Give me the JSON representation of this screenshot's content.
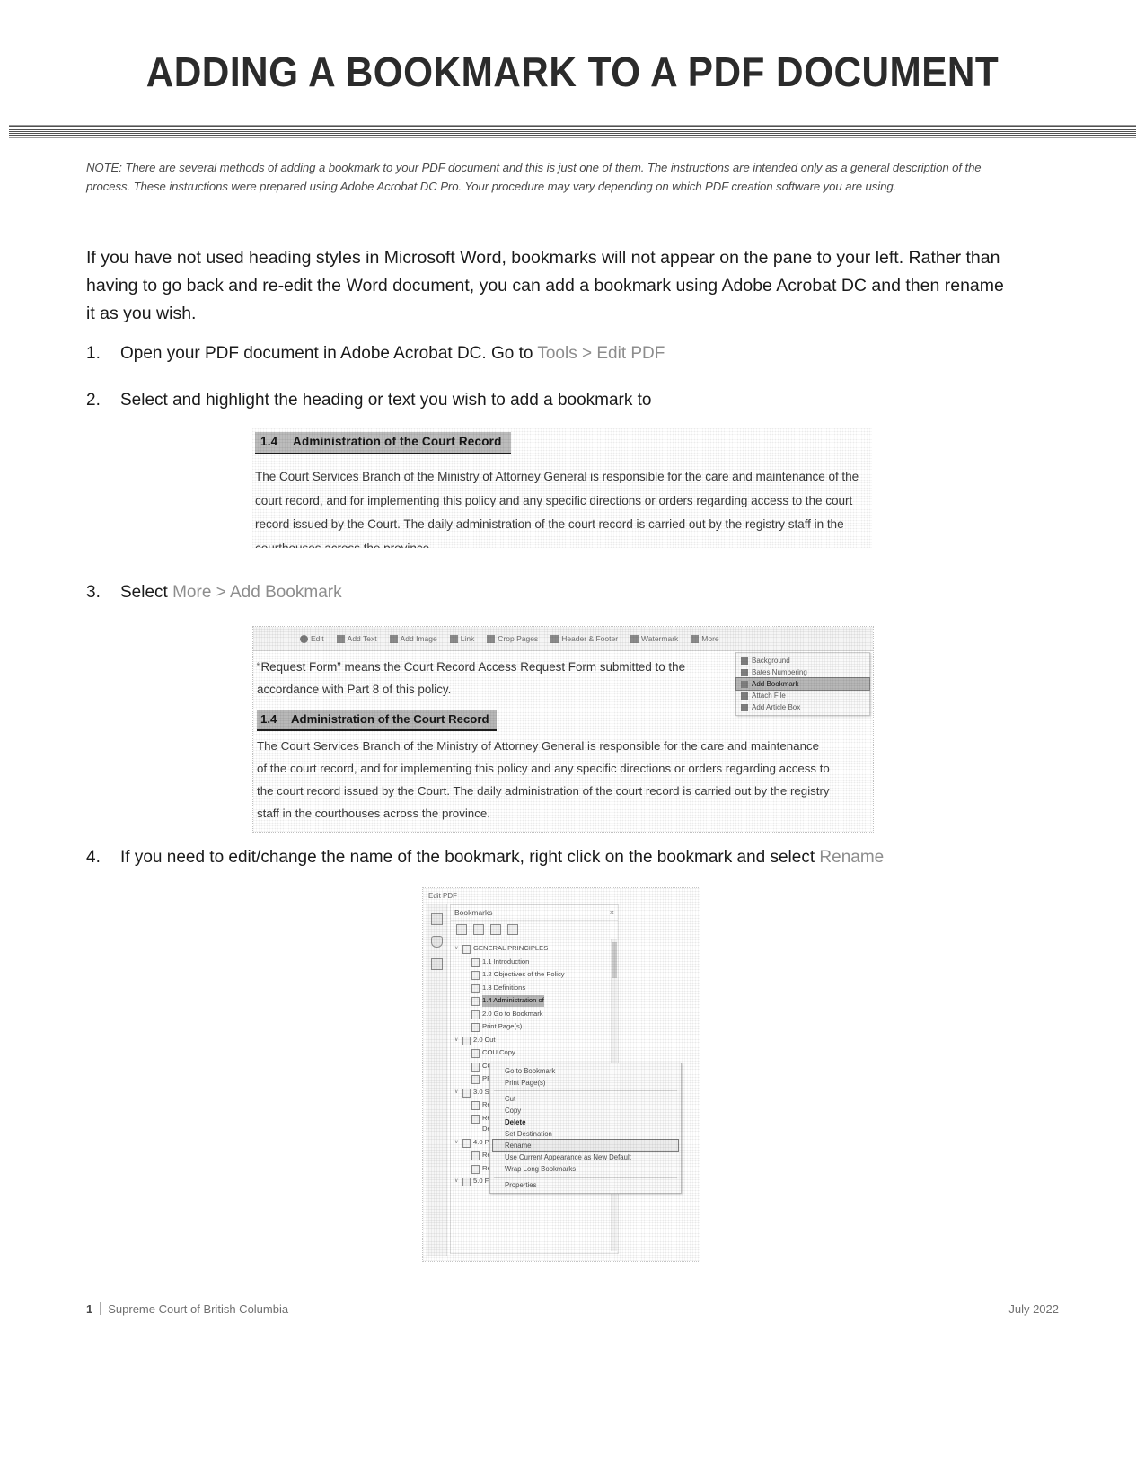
{
  "document": {
    "title": "ADDING A BOOKMARK TO A PDF DOCUMENT",
    "note": "NOTE: There are several methods of adding a bookmark to your PDF document and this is just one of them. The instructions are intended only as a general description of the process. These instructions were prepared using Adobe Acrobat DC Pro. Your procedure may vary depending on which PDF creation software you are using.",
    "intro": "If you have not used heading styles in Microsoft Word, bookmarks will not appear on the pane to your left. Rather than having to go back and re-edit the Word document, you can add a bookmark using Adobe Acrobat DC and then rename it as you wish."
  },
  "steps": [
    {
      "number": "1.",
      "text_plain": "Open your PDF document in Adobe Acrobat DC. Go to ",
      "text_faded": "Tools > Edit PDF"
    },
    {
      "number": "2.",
      "text_plain": "Select and highlight the heading or text you wish to add a bookmark to",
      "text_faded": ""
    },
    {
      "number": "3.",
      "text_plain": "Select ",
      "text_faded": "More > Add Bookmark"
    },
    {
      "number": "4.",
      "text_plain": "If you need to edit/change the name of the bookmark, right click on the bookmark and select ",
      "text_faded": "Rename"
    }
  ],
  "screenshot_heading": {
    "heading_number": "1.4",
    "heading_text": "Administration of the Court Record",
    "paragraph": "The Court Services Branch of the Ministry of Attorney General is responsible for the care and maintenance of the court record, and for implementing this policy and any specific directions or orders regarding access to the court record issued by the Court. The daily administration of the court record is carried out by the registry staff in the courthouses across the province."
  },
  "screenshot_menu": {
    "toolbar_items": [
      {
        "label": "Edit",
        "icon": "pencil-icon"
      },
      {
        "label": "Add Text",
        "icon": "add-text-icon"
      },
      {
        "label": "Add Image",
        "icon": "add-image-icon"
      },
      {
        "label": "Link",
        "icon": "link-icon"
      },
      {
        "label": "Crop Pages",
        "icon": "crop-icon"
      },
      {
        "label": "Header & Footer",
        "icon": "header-footer-icon"
      },
      {
        "label": "Watermark",
        "icon": "watermark-icon"
      },
      {
        "label": "More",
        "icon": "more-icon"
      }
    ],
    "quote_line_1": "“Request Form” means the Court Record Access Request Form submitted to the",
    "quote_line_2": "accordance with Part 8 of this policy.",
    "heading_number": "1.4",
    "heading_text": "Administration of the Court Record",
    "paragraph": "The Court Services Branch of the Ministry of Attorney General is responsible for the care and maintenance of the court record, and for implementing this policy and any specific directions or orders regarding access to the court record issued by the Court. The daily administration of the court record is carried out by the registry staff in the courthouses across the province.",
    "more_menu_items": [
      {
        "label": "Background",
        "icon": "background-icon",
        "selected": false
      },
      {
        "label": "Bates Numbering",
        "icon": "bates-icon",
        "selected": false
      },
      {
        "label": "Add Bookmark",
        "icon": "bookmark-icon",
        "selected": true
      },
      {
        "label": "Attach File",
        "icon": "attach-icon",
        "selected": false
      },
      {
        "label": "Add Article Box",
        "icon": "article-icon",
        "selected": false
      }
    ]
  },
  "screenshot_bookmarks": {
    "tool_title": "Edit PDF",
    "panel_title": "Bookmarks",
    "close_icon": "×",
    "toolbar_icons": [
      "new-bookmark-icon",
      "delete-bookmark-icon",
      "expand-icon",
      "options-icon"
    ],
    "items": [
      {
        "label": "GENERAL PRINCIPLES",
        "indent": false,
        "caret": "∨",
        "selected": false
      },
      {
        "label": "1.1 Introduction",
        "indent": true,
        "caret": "",
        "selected": false
      },
      {
        "label": "1.2 Objectives of the Policy",
        "indent": true,
        "caret": "",
        "selected": false
      },
      {
        "label": "1.3 Definitions",
        "indent": true,
        "caret": "",
        "selected": false
      },
      {
        "label": "1.4 Administration of",
        "indent": true,
        "caret": "",
        "selected": true
      },
      {
        "label": "2.0 Go to Bookmark",
        "indent": true,
        "caret": "",
        "selected": false
      },
      {
        "label": "Print Page(s)",
        "indent": true,
        "caret": "",
        "selected": false
      },
      {
        "label": "2.0  Cut",
        "indent": false,
        "caret": "∨",
        "selected": false
      },
      {
        "label": "COU   Copy",
        "indent": true,
        "caret": "",
        "selected": false
      },
      {
        "label": "CON   Cut",
        "indent": true,
        "caret": "",
        "selected": false
      },
      {
        "label": "PRO   Delete",
        "indent": true,
        "caret": "",
        "selected": false
      },
      {
        "label": "3.0   Set Destination",
        "indent": false,
        "caret": "∨",
        "selected": false
      },
      {
        "label": "Req   Rename",
        "indent": true,
        "caret": "",
        "selected": false
      },
      {
        "label": "Req   Use Current Appearance as New Default",
        "indent": true,
        "caret": "",
        "selected": false
      },
      {
        "label": "4.0   Properties",
        "indent": false,
        "caret": "∨",
        "selected": false
      },
      {
        "label": "Rec   Wrap Long Bookmarks",
        "indent": true,
        "caret": "",
        "selected": false
      },
      {
        "label": "Rec   Properties",
        "indent": true,
        "caret": "",
        "selected": false
      },
      {
        "label": "5.0  FEE",
        "indent": false,
        "caret": "∨",
        "selected": false
      }
    ],
    "context_menu": [
      {
        "label": "Go to Bookmark",
        "style": "normal"
      },
      {
        "label": "Print Page(s)",
        "style": "normal"
      },
      {
        "label": "Cut",
        "style": "normal"
      },
      {
        "label": "Copy",
        "style": "normal"
      },
      {
        "label": "Delete",
        "style": "strong"
      },
      {
        "label": "Set Destination",
        "style": "normal"
      },
      {
        "label": "Rename",
        "style": "boxed"
      },
      {
        "label": "Use Current Appearance as New Default",
        "style": "normal"
      },
      {
        "label": "Wrap Long Bookmarks",
        "style": "normal"
      },
      {
        "label": "Properties",
        "style": "normal"
      }
    ]
  },
  "footer": {
    "page_number": "1",
    "organization": "Supreme Court of British Columbia",
    "date": "July 2022"
  }
}
